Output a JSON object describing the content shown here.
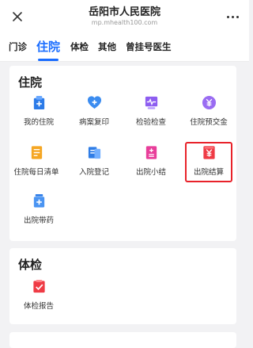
{
  "header": {
    "title": "岳阳市人民医院",
    "subtitle": "mp.mhealth100.com"
  },
  "tabs": [
    {
      "label": "门诊",
      "active": false
    },
    {
      "label": "住院",
      "active": true
    },
    {
      "label": "体检",
      "active": false
    },
    {
      "label": "其他",
      "active": false
    },
    {
      "label": "曾挂号医生",
      "active": false
    }
  ],
  "hospital_section": {
    "title": "住院",
    "items": [
      {
        "label": "我的住院",
        "icon": "my-inpatient-icon"
      },
      {
        "label": "病案复印",
        "icon": "medical-record-copy-icon"
      },
      {
        "label": "检验检查",
        "icon": "lab-exam-icon"
      },
      {
        "label": "住院预交金",
        "icon": "prepayment-icon"
      },
      {
        "label": "住院每日清单",
        "icon": "daily-list-icon"
      },
      {
        "label": "入院登记",
        "icon": "admission-registration-icon"
      },
      {
        "label": "出院小结",
        "icon": "discharge-summary-icon"
      },
      {
        "label": "出院结算",
        "icon": "discharge-settlement-icon"
      },
      {
        "label": "出院带药",
        "icon": "discharge-medication-icon"
      }
    ]
  },
  "exam_section": {
    "title": "体检",
    "items": [
      {
        "label": "体检报告",
        "icon": "exam-report-icon"
      }
    ]
  },
  "colors": {
    "accent": "#1a6dff",
    "highlight_border": "#e8222a",
    "background": "#f2f2f4"
  }
}
